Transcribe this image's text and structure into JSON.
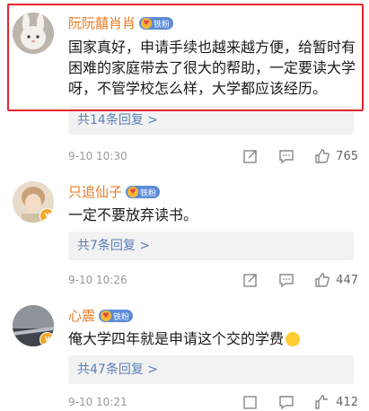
{
  "comments": [
    {
      "username": "阮阮囍肖肖",
      "badge": "铁粉",
      "text": "国家真好，申请手续也越来越方便，给暂时有困难的家庭带去了很大的帮助，一定要读大学呀，不管学校怎么样，大学都应该经历。",
      "replies": "共14条回复",
      "time": "9-10 10:30",
      "likes": "765"
    },
    {
      "username": "只追仙子",
      "badge": "铁粉",
      "text": "一定不要放弃读书。",
      "replies": "共7条回复",
      "time": "9-10 10:26",
      "likes": "447"
    },
    {
      "username": "心震",
      "badge": "铁粉",
      "text": "俺大学四年就是申请这个交的学费",
      "replies": "共47条回复",
      "time": "9-10 10:21",
      "likes": "412"
    }
  ],
  "icons": [
    "edit-icon",
    "comment-icon",
    "like-icon",
    "verified-badge-icon"
  ],
  "colors": {
    "highlight": "#e8232b",
    "username": "#e87a23",
    "reply_link": "#5a7fb5"
  }
}
